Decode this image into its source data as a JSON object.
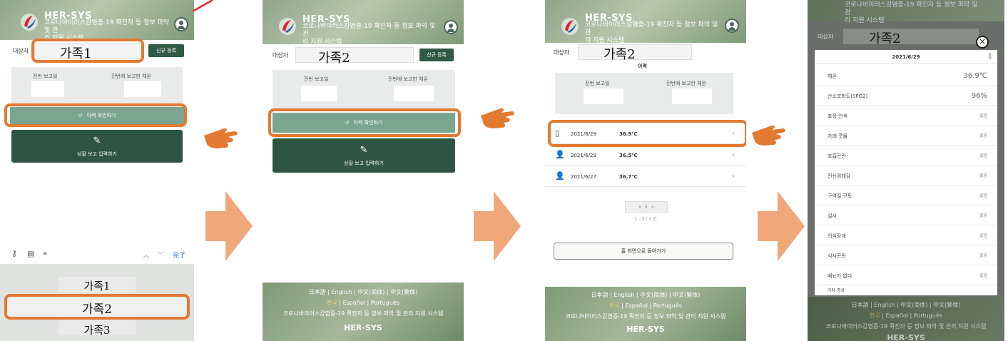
{
  "app": {
    "brand": "HER-SYS",
    "tagline": "코로나바이러스감염증-19 확진자 등 정보 파악 및 관리 지원 시스템",
    "tagline_l1": "코로나바이러스감염증-19 확진자 등 정보 파악 및 관",
    "tagline_l2": "리 지원 시스템",
    "target_label": "대상자",
    "new_register": "신규 등록",
    "last_report_date": "전번 보고일",
    "last_report_temp": "전번에 보고한 체온",
    "history_button": "이력 확인하기",
    "report_button": "상황 보고 입력하기",
    "history_title": "이력",
    "back_home": "홈 화면으로 돌아가기",
    "pagination": "1 - 3 / 3 건",
    "page_num": "1"
  },
  "panel1": {
    "selected": "가족1",
    "picker": {
      "done": "完了",
      "items": [
        "가족1",
        "가족2",
        "가족3"
      ]
    }
  },
  "panel2": {
    "selected": "가족2"
  },
  "panel3": {
    "selected": "가족2",
    "history": [
      {
        "date": "2021/6/29",
        "temp": "36.9℃",
        "icon": "phone-icon"
      },
      {
        "date": "2021/6/28",
        "temp": "36.5℃",
        "icon": "person-icon"
      },
      {
        "date": "2021/6/27",
        "temp": "36.7℃",
        "icon": "person-icon"
      }
    ]
  },
  "panel4": {
    "selected": "가족2",
    "date": "2021/6/29",
    "items": [
      {
        "name": "체온",
        "value": "36.9℃"
      },
      {
        "name": "산소포화도(SPO2)",
        "value": "96%"
      },
      {
        "name": "표정·안색",
        "value": "없음"
      },
      {
        "name": "가래·콧물",
        "value": "없음"
      },
      {
        "name": "호흡곤란",
        "value": "없음"
      },
      {
        "name": "전신권태감",
        "value": "없음"
      },
      {
        "name": "구역질·구토",
        "value": "없음"
      },
      {
        "name": "설사",
        "value": "없음"
      },
      {
        "name": "의식장애",
        "value": "없음"
      },
      {
        "name": "식사곤란",
        "value": "없음"
      },
      {
        "name": "배뇨가 없다",
        "value": "없음"
      }
    ],
    "other": "기타 증상"
  },
  "footer": {
    "langs": "日本語 | English | 中文(简体) | 中文(繁体)",
    "korean": "한국",
    "langs2": "| Español | Português",
    "tagline": "코로나바이러스감염증-19 확진자 등 정보 파악 및 관리 지원 시스템",
    "brand": "HER-SYS"
  },
  "colors": {
    "accent_orange": "#e27a32",
    "dark_green": "#2e5543",
    "mid_green": "#7aa591"
  }
}
